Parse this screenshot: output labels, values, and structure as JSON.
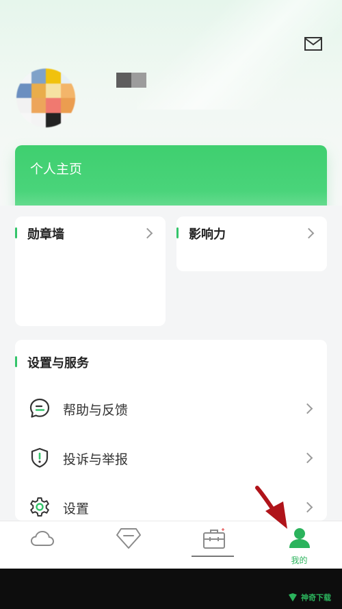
{
  "header": {
    "mail_icon": "mail-icon"
  },
  "profile": {
    "avatar": "avatar-pixelated",
    "username": ""
  },
  "home_card": {
    "label": "个人主页"
  },
  "badge_wall": {
    "label": "勋章墙"
  },
  "influence": {
    "label": "影响力"
  },
  "services": {
    "title": "设置与服务",
    "items": [
      {
        "label": "帮助与反馈",
        "icon": "chat-icon"
      },
      {
        "label": "投诉与举报",
        "icon": "shield-icon"
      },
      {
        "label": "设置",
        "icon": "gear-icon"
      }
    ]
  },
  "tabbar": {
    "tabs": [
      {
        "label": "",
        "icon": "cloud-icon",
        "active": false
      },
      {
        "label": "",
        "icon": "diamond-icon",
        "active": false
      },
      {
        "label": "",
        "icon": "briefcase-icon",
        "active": false
      },
      {
        "label": "我的",
        "icon": "person-icon",
        "active": true
      }
    ]
  },
  "watermark": {
    "text": "神奇下载"
  },
  "colors": {
    "accent": "#33c46a",
    "card_green": "#45d276",
    "tab_active": "#2bb35c",
    "arrow": "#b0141a"
  }
}
